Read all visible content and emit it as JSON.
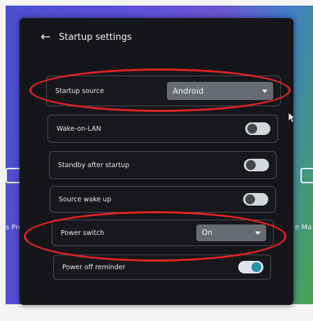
{
  "header": {
    "back_icon": "arrow-left-icon",
    "title": "Startup settings"
  },
  "desktop": {
    "left_label": "s Pro",
    "right_label": "e Ma"
  },
  "settings": {
    "startup_source": {
      "label": "Startup source",
      "value": "Android"
    },
    "wake_on_lan": {
      "label": "Wake-on-LAN",
      "state": "off"
    },
    "standby_after_startup": {
      "label": "Standby after startup",
      "state": "off"
    },
    "source_wake_up": {
      "label": "Source wake up",
      "state": "off"
    },
    "power_switch": {
      "label": "Power switch",
      "value": "On"
    },
    "power_off_reminder": {
      "label": "Power off reminder",
      "state": "on"
    }
  },
  "colors": {
    "annotation": "#e02323",
    "toggle_on": "#2b8ea8"
  }
}
